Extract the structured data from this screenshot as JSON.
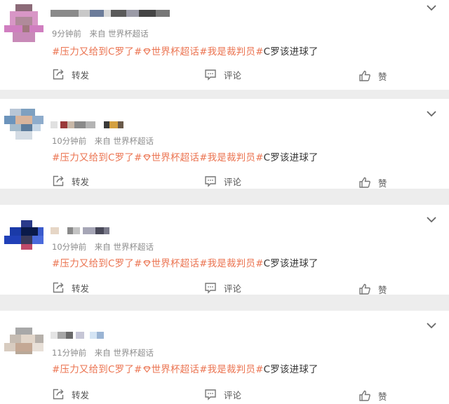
{
  "posts": [
    {
      "time": "9分钟前",
      "source_prefix": "来自",
      "source": "世界杯超话",
      "tag1": "#压力又给到C罗了#",
      "tag2": "世界杯超话",
      "tag3": "#我是裁判员#",
      "text": "C罗该进球了",
      "repost": "转发",
      "comment": "评论",
      "like": "赞"
    },
    {
      "time": "10分钟前",
      "source_prefix": "来自",
      "source": "世界杯超话",
      "tag1": "#压力又给到C罗了#",
      "tag2": "世界杯超话",
      "tag3": "#我是裁判员#",
      "text": "C罗该进球了",
      "repost": "转发",
      "comment": "评论",
      "like": "赞"
    },
    {
      "time": "10分钟前",
      "source_prefix": "来自",
      "source": "世界杯超话",
      "tag1": "#压力又给到C罗了#",
      "tag2": "世界杯超话",
      "tag3": "#我是裁判员#",
      "text": "C罗该进球了",
      "repost": "转发",
      "comment": "评论",
      "like": "赞"
    },
    {
      "time": "11分钟前",
      "source_prefix": "来自",
      "source": "世界杯超话",
      "tag1": "#压力又给到C罗了#",
      "tag2": "世界杯超话",
      "tag3": "#我是裁判员#",
      "text": "C罗该进球了",
      "repost": "转发",
      "comment": "评论",
      "like": "赞"
    }
  ],
  "colors": {
    "tag": "#eb7350",
    "meta": "#8c8c8c",
    "text": "#333333",
    "divider": "#ededed"
  },
  "icons": {
    "repost": "share-arrow-icon",
    "comment": "speech-bubble-icon",
    "like": "thumbs-up-icon",
    "menu": "chevron-down-icon",
    "supertopic": "diamond-icon"
  }
}
